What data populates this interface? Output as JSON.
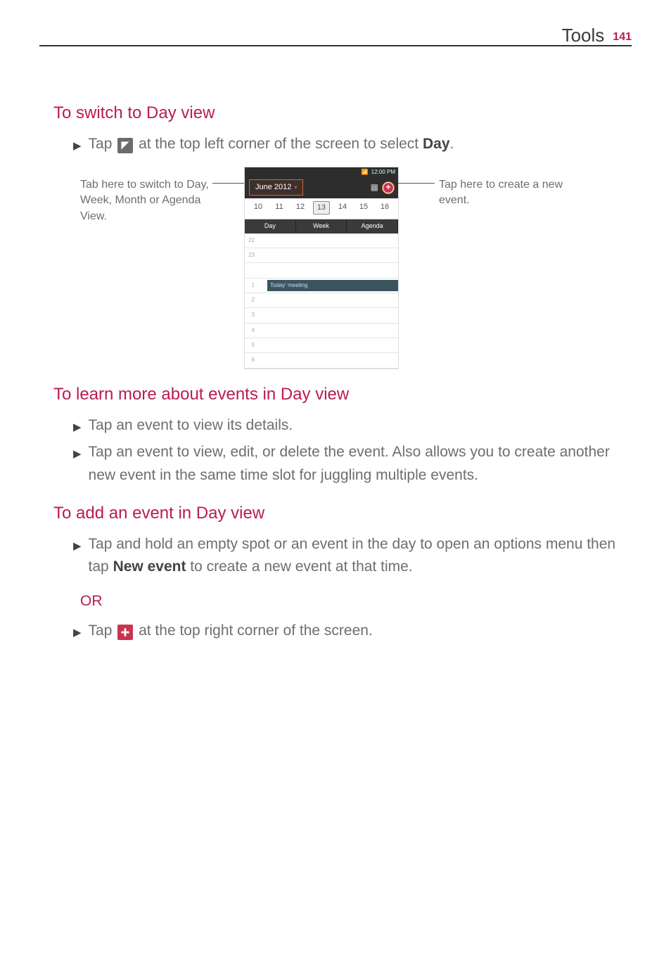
{
  "header": {
    "section": "Tools",
    "page": "141"
  },
  "sections": {
    "switch": {
      "title": "To switch to Day view",
      "bullet_prefix": "Tap ",
      "bullet_suffix": " at the top left corner of the screen to select ",
      "bullet_bold": "Day",
      "bullet_period": "."
    },
    "learn": {
      "title": "To learn more about events in Day view",
      "b1": "Tap an event to view its details.",
      "b2": "Tap an event to view, edit, or delete the event. Also allows you to create another new event in the same time slot for juggling multiple events."
    },
    "add": {
      "title": "To add an event in Day view",
      "b1_prefix": "Tap and hold an empty spot or an event in the day to open an options menu then tap ",
      "b1_bold": "New event",
      "b1_suffix": " to create a new event at that time.",
      "or": "OR",
      "b2_prefix": "Tap ",
      "b2_suffix": " at the top right corner of the screen."
    }
  },
  "callouts": {
    "left": "Tab here to switch to Day, Week, Month or Agenda View.",
    "right": "Tap here to create a new event."
  },
  "phone": {
    "time": "12:00 PM",
    "month_label": "June 2012",
    "dates": [
      "10",
      "11",
      "12",
      "13",
      "14",
      "15",
      "16"
    ],
    "selected_index": 3,
    "tabs": [
      "Day",
      "Week",
      "Agenda"
    ],
    "event_label": "Today' meeting",
    "hours": [
      "22",
      "23",
      "1",
      "2",
      "3",
      "4",
      "5",
      "6"
    ]
  },
  "icons": {
    "dropdown_triangle": "dropdown-triangle-icon",
    "add_event_circle": "add-event-plus-icon"
  }
}
